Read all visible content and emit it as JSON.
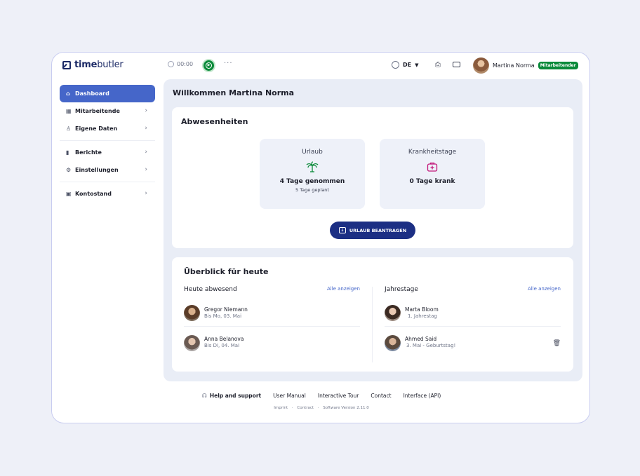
{
  "header": {
    "logo_bold": "time",
    "logo_rest": "butler",
    "timer": "00:00",
    "more": "···",
    "language": "DE",
    "user_name": "Martina Norma",
    "user_badge": "Mitarbeitender"
  },
  "sidebar": {
    "items": [
      {
        "label": "Dashboard",
        "icon": "home-icon",
        "active": true
      },
      {
        "label": "Mitarbeitende",
        "icon": "building-icon"
      },
      {
        "label": "Eigene Daten",
        "icon": "person-icon"
      },
      {
        "label": "Berichte",
        "icon": "chart-icon"
      },
      {
        "label": "Einstellungen",
        "icon": "gear-icon"
      },
      {
        "label": "Kontostand",
        "icon": "wallet-icon"
      }
    ]
  },
  "main": {
    "welcome": "Willkommen Martina Norma",
    "absences": {
      "title": "Abwesenheiten",
      "vacation": {
        "label": "Urlaub",
        "main": "4 Tage genommen",
        "sub": "5 Tage geplant"
      },
      "sick": {
        "label": "Krankheitstage",
        "main": "0 Tage krank"
      },
      "button": "URLAUB BEANTRAGEN"
    },
    "overview": {
      "title": "Überblick für heute",
      "absent": {
        "heading": "Heute abwesend",
        "link": "Alle anzeigen",
        "entries": [
          {
            "name": "Gregor Niemann",
            "sub": "Bis Mo, 03. Mai"
          },
          {
            "name": "Anna Belanova",
            "sub": "Bis Di, 04. Mai"
          }
        ]
      },
      "anniversaries": {
        "heading": "Jahrestage",
        "link": "Alle anzeigen",
        "entries": [
          {
            "name": "Marta Bloom",
            "sub": "1. Jahrestag"
          },
          {
            "name": "Ahmed Said",
            "sub": "3. Mai - Geburtstag!"
          }
        ]
      }
    }
  },
  "footer": {
    "help": "Help and support",
    "manual": "User Manual",
    "tour": "Interactive Tour",
    "contact": "Contact",
    "api": "Interface (API)",
    "imprint": "Imprint",
    "contract": "Contract",
    "version": "Software Version 2.11.0",
    "sep": "·"
  },
  "colors": {
    "primary": "#4566c9",
    "button": "#1c2f84",
    "green": "#0a8a3a",
    "sick": "#c2187a"
  }
}
